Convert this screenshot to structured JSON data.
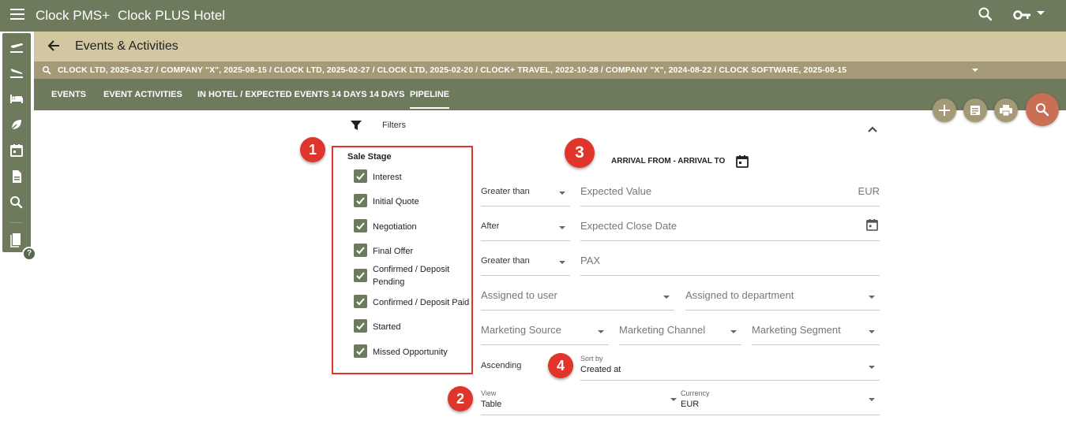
{
  "topbar": {
    "app_title": "Clock PMS+",
    "hotel_name": "Clock PLUS Hotel"
  },
  "page": {
    "title": "Events & Activities"
  },
  "breadcrumbs": "CLOCK LTD, 2025-03-27  /  COMPANY \"X\", 2025-08-15  /  CLOCK LTD, 2025-02-27  /  CLOCK LTD, 2025-02-20  /  CLOCK+ TRAVEL, 2022-10-28  /  COMPANY \"X\", 2024-08-22  /  CLOCK SOFTWARE, 2025-08-15",
  "tabs": [
    {
      "label": "EVENTS"
    },
    {
      "label": "EVENT ACTIVITIES"
    },
    {
      "label": "IN HOTEL / EXPECTED EVENTS 14 DAYS 14 DAYS"
    },
    {
      "label": "PIPELINE"
    }
  ],
  "filters": {
    "label": "Filters"
  },
  "markers": [
    "1",
    "2",
    "3",
    "4"
  ],
  "sale_stage": {
    "title": "Sale Stage",
    "items": [
      {
        "label": "Interest"
      },
      {
        "label": "Initial Quote"
      },
      {
        "label": "Negotiation"
      },
      {
        "label": "Final Offer"
      },
      {
        "label": "Confirmed / Deposit",
        "label2": "Pending"
      },
      {
        "label": "Confirmed / Deposit Paid"
      },
      {
        "label": "Started"
      },
      {
        "label": "Missed Opportunity"
      }
    ]
  },
  "arrival_label": "ARRIVAL FROM - ARRIVAL TO",
  "fields": {
    "value_op": "Greater than",
    "value_ph": "Expected Value",
    "value_currency": "EUR",
    "date_op": "After",
    "date_ph": "Expected Close Date",
    "pax_op": "Greater than",
    "pax_ph": "PAX",
    "assigned_user": "Assigned to user",
    "assigned_department": "Assigned to department",
    "marketing_source": "Marketing Source",
    "marketing_channel": "Marketing Channel",
    "marketing_segment": "Marketing Segment",
    "sort_order": "Ascending",
    "sort_by_label": "Sort by",
    "sort_by_value": "Created at",
    "view_label": "View",
    "view_value": "Table",
    "currency_label": "Currency",
    "currency_value": "EUR"
  },
  "colors": {
    "header": "#6d7a5c",
    "title_bar": "#d3c7a1",
    "crumb_bar": "#a59a78",
    "accent_red": "#e0352b",
    "fab_search": "#c86f55"
  }
}
